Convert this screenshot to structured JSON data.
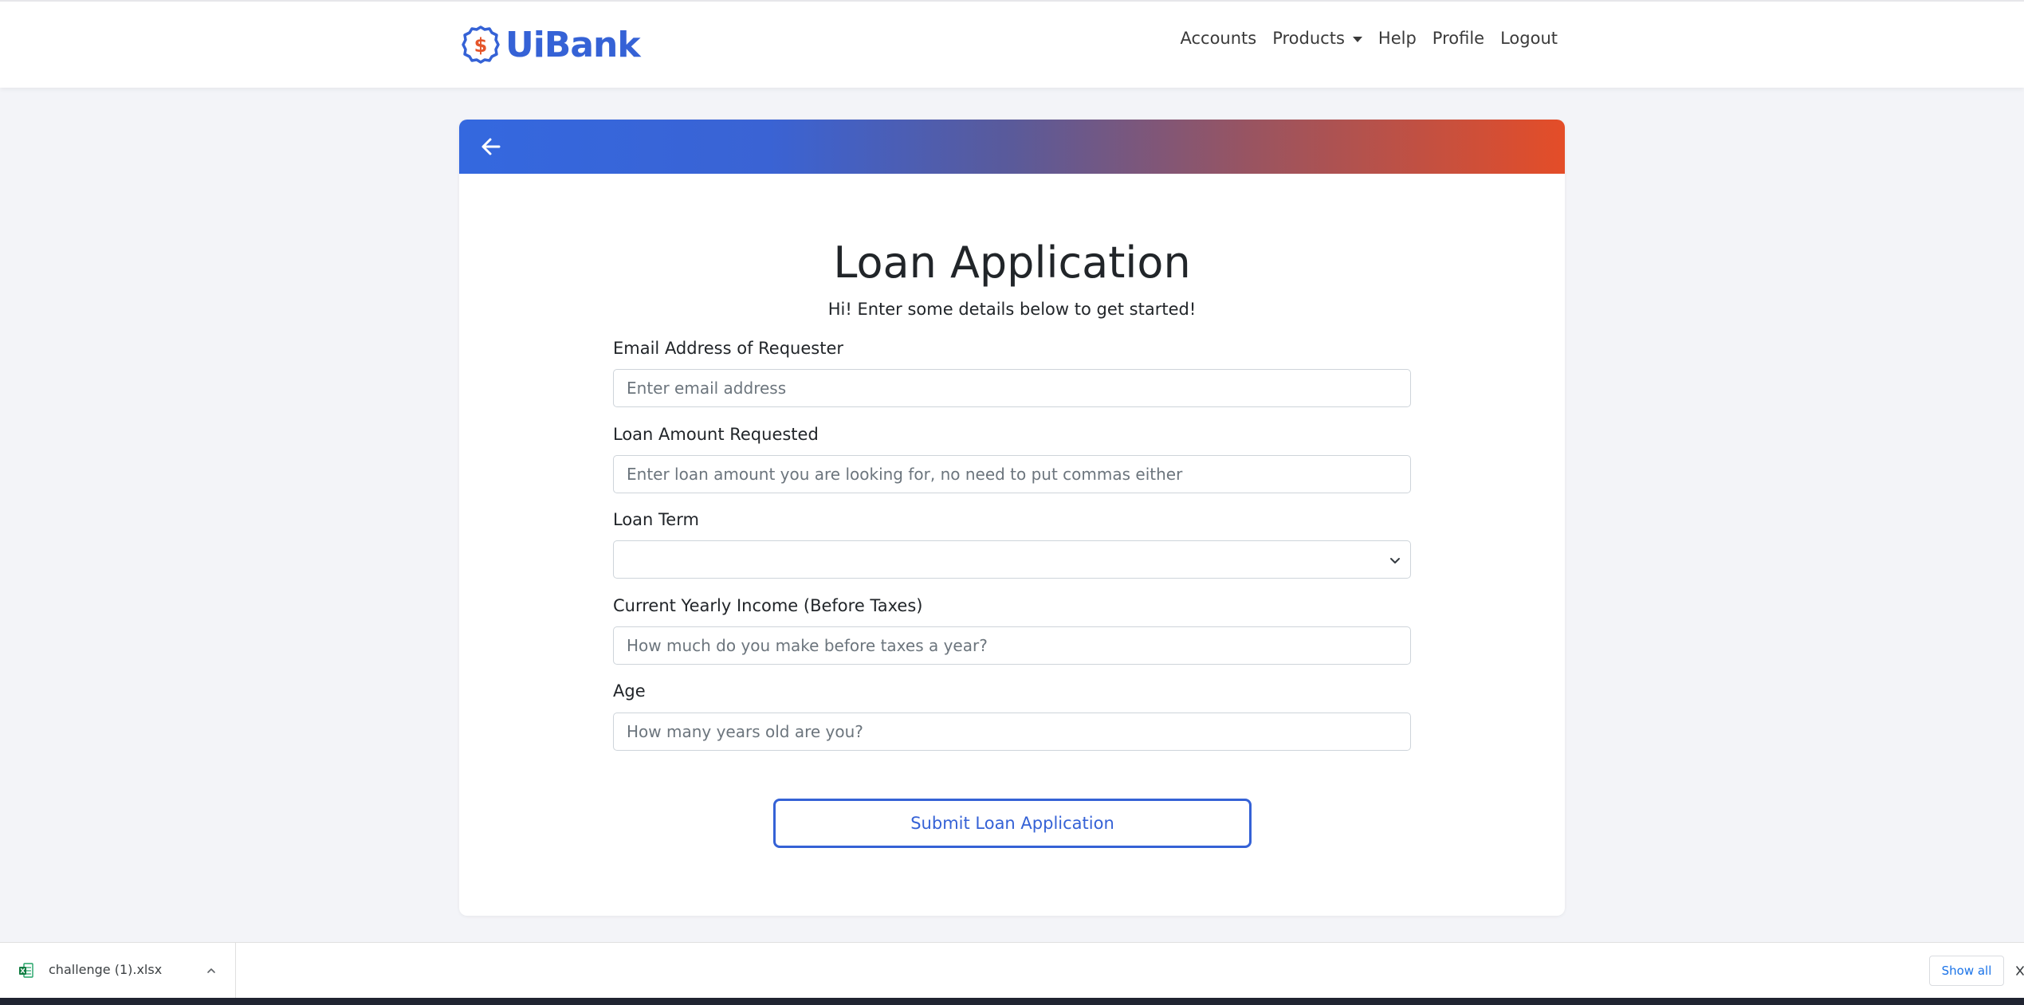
{
  "brand": {
    "name": "UiBank",
    "logo_symbol": "$",
    "color": "#3562d6",
    "accent": "#e5552a"
  },
  "nav": {
    "accounts": "Accounts",
    "products": "Products",
    "help": "Help",
    "profile": "Profile",
    "logout": "Logout"
  },
  "card": {
    "back_icon": "arrow-left-icon",
    "title": "Loan Application",
    "subtitle": "Hi! Enter some details below to get started!"
  },
  "form": {
    "email": {
      "label": "Email Address of Requester",
      "placeholder": "Enter email address"
    },
    "amount": {
      "label": "Loan Amount Requested",
      "placeholder": "Enter loan amount you are looking for, no need to put commas either"
    },
    "term": {
      "label": "Loan Term",
      "value": ""
    },
    "income": {
      "label": "Current Yearly Income (Before Taxes)",
      "placeholder": "How much do you make before taxes a year?"
    },
    "age": {
      "label": "Age",
      "placeholder": "How many years old are you?"
    },
    "submit_label": "Submit Loan Application"
  },
  "downloads": {
    "file_name": "challenge (1).xlsx",
    "show_all": "Show all"
  }
}
